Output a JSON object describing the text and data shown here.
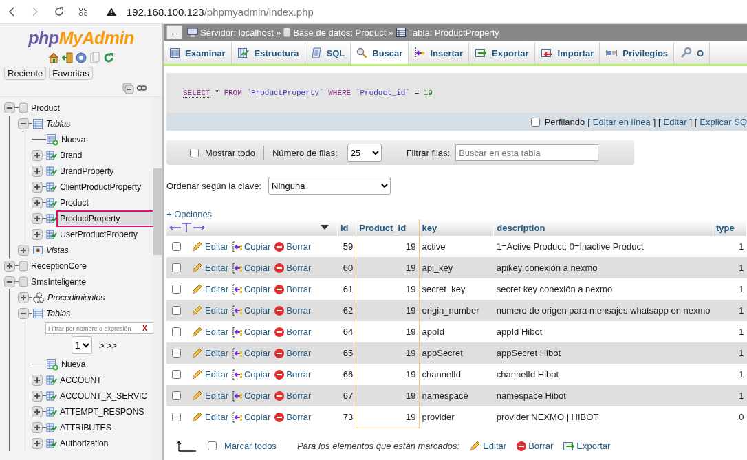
{
  "browser": {
    "host": "192.168.100.123",
    "path": "/phpmyadmin/index.php"
  },
  "sidebar": {
    "logo": {
      "part_1": "php",
      "part_2": "MyAdmin"
    },
    "buttons": [
      "Reciente",
      "Favoritas"
    ],
    "tree": [
      {
        "kind": "db",
        "label": "Product",
        "expanded": true,
        "selected": false,
        "children": [
          {
            "kind": "group",
            "label": "Tablas",
            "expanded": true,
            "selected": false,
            "children": [
              {
                "kind": "new",
                "label": "Nueva",
                "selected": false
              },
              {
                "kind": "table",
                "label": "Brand",
                "expanded": false,
                "selected": false
              },
              {
                "kind": "table",
                "label": "BrandProperty",
                "expanded": false,
                "selected": false
              },
              {
                "kind": "table",
                "label": "ClientProductProperty",
                "expanded": false,
                "selected": false
              },
              {
                "kind": "table",
                "label": "Product",
                "expanded": false,
                "selected": false
              },
              {
                "kind": "table",
                "label": "ProductProperty",
                "expanded": false,
                "selected": true
              },
              {
                "kind": "table",
                "label": "UserProductProperty",
                "expanded": false,
                "selected": false
              }
            ]
          },
          {
            "kind": "views",
            "label": "Vistas",
            "expanded": false,
            "selected": false
          }
        ]
      },
      {
        "kind": "db",
        "label": "ReceptionCore",
        "expanded": false,
        "selected": false
      },
      {
        "kind": "db",
        "label": "SmsInteligente",
        "expanded": true,
        "selected": false,
        "children": [
          {
            "kind": "procedures",
            "label": "Procedimientos",
            "expanded": false,
            "selected": false
          },
          {
            "kind": "group",
            "label": "Tablas",
            "expanded": true,
            "selected": false,
            "filter": {
              "placeholder": "Filtrar por nombre o expresión",
              "clear": "X"
            },
            "pager": {
              "page": "1",
              "next": "> >>"
            },
            "children": [
              {
                "kind": "new",
                "label": "Nueva",
                "selected": false
              },
              {
                "kind": "table",
                "label": "ACCOUNT",
                "expanded": false,
                "selected": false
              },
              {
                "kind": "table",
                "label": "ACCOUNT_X_SERVIC",
                "expanded": false,
                "selected": false
              },
              {
                "kind": "table",
                "label": "ATTEMPT_RESPONS",
                "expanded": false,
                "selected": false
              },
              {
                "kind": "table",
                "label": "ATTRIBUTES",
                "expanded": false,
                "selected": false
              },
              {
                "kind": "table",
                "label": "Authorization",
                "expanded": false,
                "selected": false
              }
            ]
          }
        ]
      }
    ]
  },
  "back": "←",
  "breadcrumb": [
    "Servidor: localhost",
    "»",
    "Base de datos: Product",
    "»",
    "Tabla: ProductProperty"
  ],
  "tabs": [
    {
      "label": "Examinar",
      "selected": false
    },
    {
      "label": "Estructura",
      "selected": false
    },
    {
      "label": "SQL",
      "selected": false
    },
    {
      "label": "Buscar",
      "selected": true
    },
    {
      "label": "Insertar",
      "selected": false
    },
    {
      "label": "Exportar",
      "selected": false
    },
    {
      "label": "Importar",
      "selected": false
    },
    {
      "label": "Privilegios",
      "selected": false
    },
    {
      "label": "O",
      "selected": false
    }
  ],
  "query": [
    {
      "kind": "keyword",
      "text": "SELECT"
    },
    {
      "kind": "symbol",
      "text": "*"
    },
    {
      "kind": "keyword",
      "text": "FROM"
    },
    {
      "kind": "identifier",
      "text": "`ProductProperty`"
    },
    {
      "kind": "keyword",
      "text": "WHERE"
    },
    {
      "kind": "identifier",
      "text": "`Product_id`"
    },
    {
      "kind": "symbol",
      "text": "="
    },
    {
      "kind": "number",
      "text": "19"
    }
  ],
  "profiling": {
    "label": "Perfilando",
    "checked": false,
    "items": [
      {
        "kind": "text",
        "text": "["
      },
      {
        "kind": "link",
        "text": "Editar en línea"
      },
      {
        "kind": "text",
        "text": "] ["
      },
      {
        "kind": "link",
        "text": "Editar"
      },
      {
        "kind": "text",
        "text": "] ["
      },
      {
        "kind": "link",
        "text": "Explicar SQ"
      }
    ]
  },
  "controls": {
    "show_all": {
      "label": "Mostrar todo",
      "checked": false
    },
    "rows_label": "Número de filas:",
    "rows_value": "25",
    "filter_label": "Filtrar filas:",
    "filter_placeholder": "Buscar en esta tabla",
    "sort_label": "Ordenar según la clave:",
    "sort_value": "Ninguna",
    "options_link": "+ Opciones"
  },
  "table": {
    "columns": [
      {
        "label": "id",
        "highlighted": false
      },
      {
        "label": "Product_id",
        "highlighted": true
      },
      {
        "label": "key",
        "highlighted": false
      },
      {
        "label": "description",
        "highlighted": false
      },
      {
        "label": "type",
        "highlighted": false
      }
    ],
    "rows": [
      {
        "checked": false,
        "actions": [
          "Editar",
          "Copiar",
          "Borrar"
        ],
        "cells": [
          "59",
          "19",
          "active",
          "1=Active Product; 0=Inactive Product",
          "1"
        ]
      },
      {
        "checked": false,
        "actions": [
          "Editar",
          "Copiar",
          "Borrar"
        ],
        "cells": [
          "60",
          "19",
          "api_key",
          "apikey conexión a nexmo",
          "1"
        ]
      },
      {
        "checked": false,
        "actions": [
          "Editar",
          "Copiar",
          "Borrar"
        ],
        "cells": [
          "61",
          "19",
          "secret_key",
          "secret key conexión a nexmo",
          "1"
        ]
      },
      {
        "checked": false,
        "actions": [
          "Editar",
          "Copiar",
          "Borrar"
        ],
        "cells": [
          "62",
          "19",
          "origin_number",
          "numero de origen para mensajes whatsapp en nexmo",
          "1"
        ]
      },
      {
        "checked": false,
        "actions": [
          "Editar",
          "Copiar",
          "Borrar"
        ],
        "cells": [
          "64",
          "19",
          "appId",
          "appId Hibot",
          "1"
        ]
      },
      {
        "checked": false,
        "actions": [
          "Editar",
          "Copiar",
          "Borrar"
        ],
        "cells": [
          "65",
          "19",
          "appSecret",
          "appSecret Hibot",
          "1"
        ]
      },
      {
        "checked": false,
        "actions": [
          "Editar",
          "Copiar",
          "Borrar"
        ],
        "cells": [
          "66",
          "19",
          "channelId",
          "channelId Hibot",
          "1"
        ]
      },
      {
        "checked": false,
        "actions": [
          "Editar",
          "Copiar",
          "Borrar"
        ],
        "cells": [
          "67",
          "19",
          "namespace",
          "namespace Hibot",
          "1"
        ]
      },
      {
        "checked": false,
        "actions": [
          "Editar",
          "Copiar",
          "Borrar"
        ],
        "cells": [
          "73",
          "19",
          "provider",
          "provider NEXMO | HIBOT",
          "0"
        ]
      }
    ]
  },
  "footer": {
    "check_all": {
      "label": "Marcar todos",
      "checked": false
    },
    "note": "Para los elementos que están marcados:",
    "actions": [
      "Editar",
      "Borrar",
      "Exportar"
    ]
  }
}
